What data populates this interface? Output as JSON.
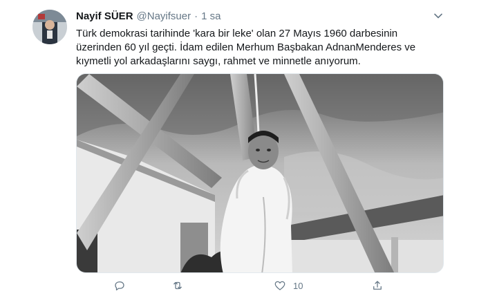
{
  "tweet": {
    "author_name": "Nayif SÜER",
    "author_handle": "@Nayifsuer",
    "separator": "·",
    "time": "1 sa",
    "text_lines": [
      "Türk demokrasi tarihinde 'kara bir leke' olan 27 Mayıs 1960 darbesinin",
      "üzerinden 60 yıl geçti. İdam edilen Merhum Başbakan AdnanMenderes ve",
      "kıymetli yol arkadaşlarını saygı, rahmet ve minnetle anıyorum."
    ],
    "media": {
      "type": "black-and-white photo"
    },
    "actions": [
      {
        "name": "reply",
        "icon": "reply-icon",
        "count": ""
      },
      {
        "name": "retweet",
        "icon": "retweet-icon",
        "count": ""
      },
      {
        "name": "like",
        "icon": "heart-icon",
        "count": "10"
      },
      {
        "name": "share",
        "icon": "share-icon",
        "count": ""
      }
    ]
  },
  "colors": {
    "text": "#14171a",
    "secondary": "#657786",
    "border": "#e1e8ed"
  }
}
